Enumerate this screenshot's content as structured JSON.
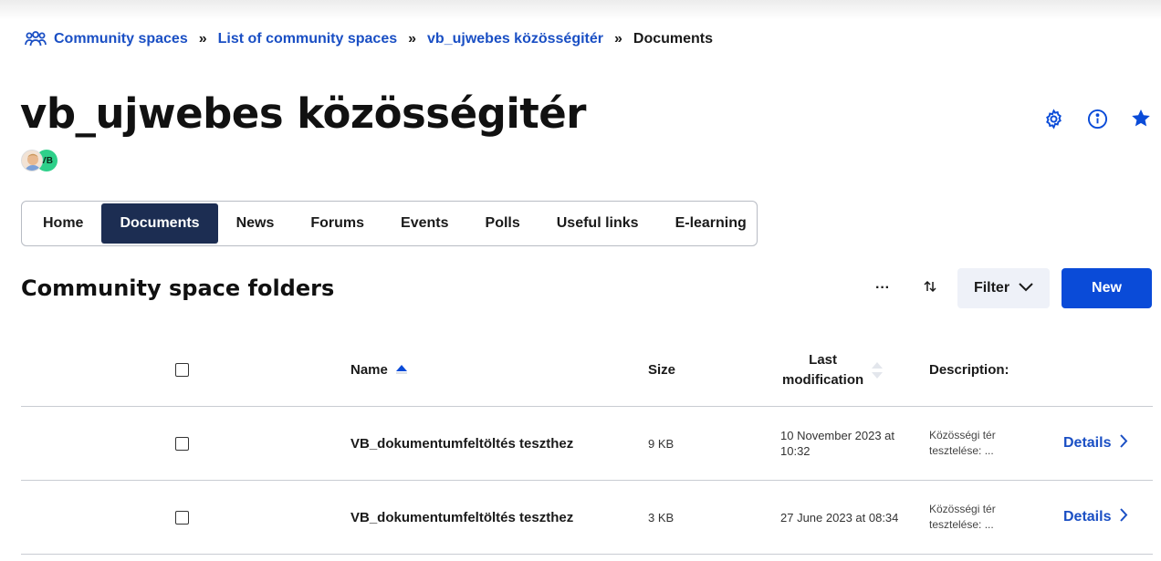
{
  "breadcrumb": {
    "items": [
      "Community spaces",
      "List of community spaces",
      "vb_ujwebes közösségitér"
    ],
    "current": "Documents",
    "separator": "»"
  },
  "page": {
    "title": "vb_ujwebes közösségitér",
    "member_initials": "VB"
  },
  "tabs": [
    {
      "label": "Home",
      "active": false
    },
    {
      "label": "Documents",
      "active": true
    },
    {
      "label": "News",
      "active": false
    },
    {
      "label": "Forums",
      "active": false
    },
    {
      "label": "Events",
      "active": false
    },
    {
      "label": "Polls",
      "active": false
    },
    {
      "label": "Useful links",
      "active": false
    },
    {
      "label": "E-learning",
      "active": false
    }
  ],
  "section": {
    "title": "Community space folders",
    "more_label": "···",
    "filter_label": "Filter",
    "new_label": "New"
  },
  "table": {
    "columns": {
      "name": "Name",
      "size": "Size",
      "last_mod_line1": "Last",
      "last_mod_line2": "modification",
      "description": "Description:"
    },
    "rows": [
      {
        "name": "VB_dokumentumfeltöltés teszthez",
        "size": "9 KB",
        "date_line1": "10 November 2023 at",
        "date_line2": "10:32",
        "desc_line1": "Közösségi tér",
        "desc_line2": "tesztelése: ...",
        "details": "Details"
      },
      {
        "name": "VB_dokumentumfeltöltés teszthez",
        "size": "3 KB",
        "date_line1": "27 June 2023 at 08:34",
        "date_line2": "",
        "desc_line1": "Közösségi tér",
        "desc_line2": "tesztelése: ...",
        "details": "Details"
      }
    ]
  },
  "colors": {
    "link": "#1a4fc4",
    "active_tab": "#1c2d52",
    "primary_button": "#0a4bd8",
    "secondary_button": "#eef1f8"
  },
  "icons": [
    "community-icon",
    "gear-icon",
    "info-icon",
    "star-icon",
    "sort-icon",
    "chevron-down-icon",
    "chevron-right-icon"
  ]
}
